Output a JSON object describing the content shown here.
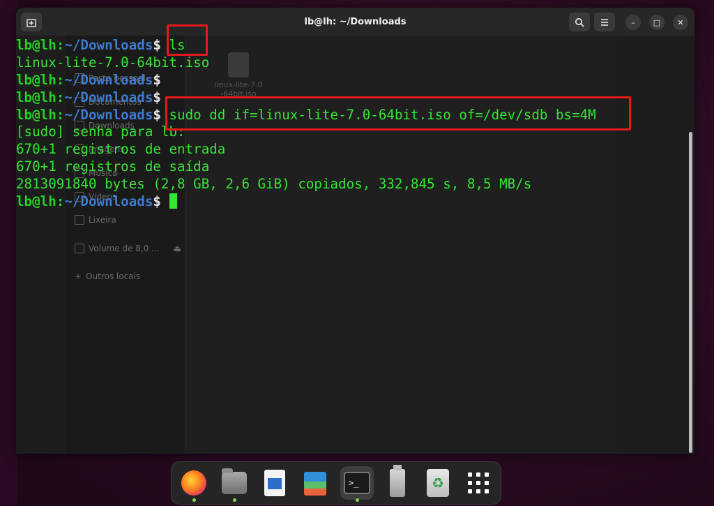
{
  "window": {
    "title": "lb@lh: ~/Downloads"
  },
  "background_file_manager": {
    "sidebar_items": [
      "Pasta pessoal",
      "Documentos",
      "Downloads",
      "Imagens",
      "Música",
      "Vídeos",
      "Lixeira",
      "Volume de 8,0 ...",
      "Outros locais"
    ],
    "file_name": "linux-lite-7.0-64bit.iso"
  },
  "terminal": {
    "prompt": {
      "user_host": "lb@lh",
      "colon": ":",
      "path": "~/Downloads",
      "symbol": "$ "
    },
    "lines": [
      {
        "type": "prompt",
        "command": "ls"
      },
      {
        "type": "output",
        "text": "linux-lite-7.0-64bit.iso"
      },
      {
        "type": "prompt",
        "command": ""
      },
      {
        "type": "prompt",
        "command": ""
      },
      {
        "type": "prompt",
        "command": "sudo dd if=linux-lite-7.0-64bit.iso of=/dev/sdb bs=4M"
      },
      {
        "type": "output",
        "text": "[sudo] senha para lb:"
      },
      {
        "type": "output",
        "text": "670+1 registros de entrada"
      },
      {
        "type": "output",
        "text": "670+1 registros de saída"
      },
      {
        "type": "output",
        "text": "2813091840 bytes (2,8 GB, 2,6 GiB) copiados, 332,845 s, 8,5 MB/s"
      },
      {
        "type": "prompt",
        "command": "",
        "cursor": true
      }
    ]
  },
  "dock": {
    "items": [
      {
        "name": "firefox",
        "running": true
      },
      {
        "name": "files",
        "running": true
      },
      {
        "name": "libreoffice-writer",
        "running": false
      },
      {
        "name": "layers-app",
        "running": false
      },
      {
        "name": "terminal",
        "running": true,
        "active": true
      },
      {
        "name": "usb-drive",
        "running": false
      },
      {
        "name": "trash",
        "running": false
      },
      {
        "name": "show-apps",
        "running": false
      }
    ],
    "terminal_glyph": ">_"
  },
  "colors": {
    "prompt_user": "#24d024",
    "prompt_path": "#3a7bd5",
    "output_text": "#33e633",
    "highlight": "#e41a1a",
    "terminal_bg": "#1d1d1d"
  }
}
